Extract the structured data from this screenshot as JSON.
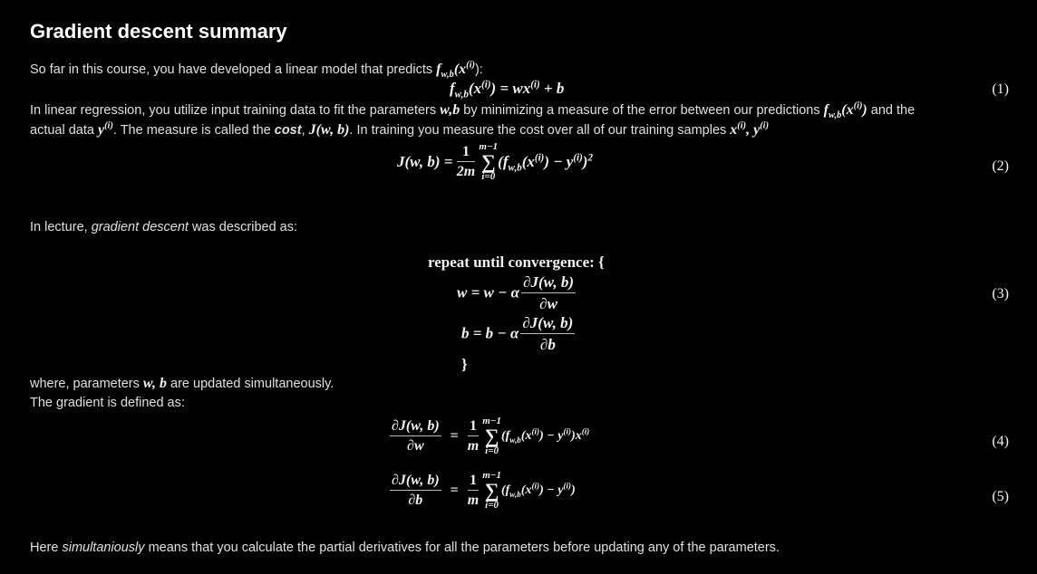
{
  "title": "Gradient descent summary",
  "intro": {
    "text": "So far in this course, you have developed a linear model that predicts ",
    "func": "f",
    "sub": "w,b",
    "arg": "(x",
    "sup": "(i)",
    "tail": "):"
  },
  "eq1": {
    "lhs_f": "f",
    "lhs_sub": "w,b",
    "lhs_arg": "(x",
    "lhs_sup": "(i)",
    "lhs_close": ")",
    "rhs": "= wx",
    "rhs_sup": "(i)",
    "rhs_tail": " + b",
    "number": "(1)"
  },
  "regression": {
    "t1": "In linear regression, you utilize input training data to fit the parameters ",
    "params": "w",
    "comma_b": ",b",
    "t2": " by minimizing a measure of the error between our predictions ",
    "pred_f": "f",
    "pred_sub": "w,b",
    "pred_arg": "(x",
    "pred_sup": "(i)",
    "pred_close": ")",
    "t3": " and the",
    "line2_a": "actual data ",
    "y": "y",
    "y_sup": "(i)",
    "line2_b": ". The measure is called the ",
    "cost_word": "cost",
    "comma": ", ",
    "cost_fn": "J(w, b)",
    "line2_c": ". In training you measure the cost over all of our training samples ",
    "samples_x": "x",
    "samples_x_sup": "(i)",
    "samples_sep": ", ",
    "samples_y": "y",
    "samples_y_sup": "(i)"
  },
  "eq2": {
    "lhs": "J(w, b) =",
    "frac_num": "1",
    "frac_den": "2m",
    "sum_top": "m−1",
    "sum_sym": "∑",
    "sum_bot": "i=0",
    "body_open": "(f",
    "body_sub": "w,b",
    "body_arg": "(x",
    "body_sup": "(i)",
    "body_mid": ") − y",
    "body_sup2": "(i)",
    "body_close": ")",
    "body_pow": "2",
    "number": "(2)"
  },
  "lecture": {
    "a": "In lecture, ",
    "gd": "gradient descent",
    "b": " was described as:"
  },
  "eq3": {
    "repeat": "repeat until convergence: {",
    "w_lhs": "w = w − α",
    "w_num": "∂J(w, b)",
    "w_den": "∂w",
    "b_lhs": "b = b − α",
    "b_num": "∂J(w, b)",
    "b_den": "∂b",
    "close": "}",
    "number": "(3)"
  },
  "simul": {
    "a": "where, parameters ",
    "w": "w",
    "sep": ", ",
    "b": "b",
    "c": " are updated simultaneously.",
    "line2": "The gradient is defined as:"
  },
  "eq4": {
    "num": "∂J(w, b)",
    "den": "∂w",
    "eq": "=",
    "frac_num": "1",
    "frac_den": "m",
    "sum_top": "m−1",
    "sum_sym": "∑",
    "sum_bot": "i=0",
    "body_open": "(f",
    "body_sub": "w,b",
    "body_arg": "(x",
    "body_sup": "(i)",
    "body_mid": ") − y",
    "body_sup2": "(i)",
    "body_close": ")x",
    "body_sup3": "(i)",
    "number": "(4)"
  },
  "eq5": {
    "num": "∂J(w, b)",
    "den": "∂b",
    "eq": "=",
    "frac_num": "1",
    "frac_den": "m",
    "sum_top": "m−1",
    "sum_sym": "∑",
    "sum_bot": "i=0",
    "body_open": "(f",
    "body_sub": "w,b",
    "body_arg": "(x",
    "body_sup": "(i)",
    "body_mid": ") − y",
    "body_sup2": "(i)",
    "body_close": ")",
    "number": "(5)"
  },
  "footer": {
    "a": "Here ",
    "simul": "simultaniously",
    "b": " means that you calculate the partial derivatives for all the parameters before updating any of the parameters."
  }
}
